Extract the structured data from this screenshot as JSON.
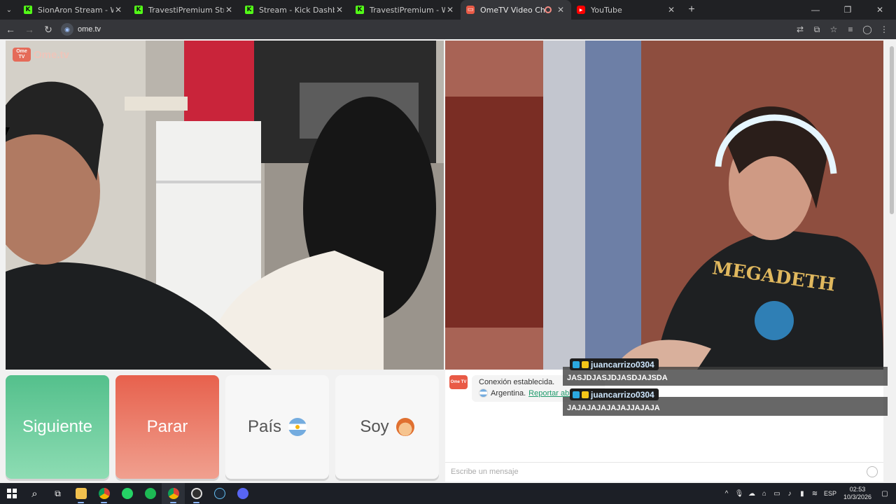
{
  "browser": {
    "tabs": [
      {
        "title": "SionAron Stream - Watch Live o",
        "favicon": "kick-icon",
        "active": false
      },
      {
        "title": "TravestiPremium Stream - Watc",
        "favicon": "kick-icon",
        "active": false
      },
      {
        "title": "Stream - Kick Dashboard",
        "favicon": "kick-icon",
        "active": false
      },
      {
        "title": "TravestiPremium - Watch clips o",
        "favicon": "kick-icon",
        "active": false
      },
      {
        "title": "OmeTV Video Chat — Ome",
        "favicon": "ometv-icon",
        "active": true
      },
      {
        "title": "YouTube",
        "favicon": "youtube-icon",
        "active": false
      }
    ],
    "url": "ome.tv"
  },
  "page": {
    "logo": {
      "wordmark": "Ome.tv",
      "badge": "Ome TV"
    },
    "buttons": {
      "next": "Siguiente",
      "stop": "Parar",
      "country": "País",
      "gender": "Soy"
    },
    "chat": {
      "system_badge": "Ome TV",
      "connected": "Conexión establecida.",
      "country": "Argentina.",
      "report": "Reportar abus",
      "placeholder": "Escribe un mensaje"
    }
  },
  "stream_overlay": {
    "messages": [
      {
        "user": "juancarrizo0304",
        "text": "JASJDJASJDJASDJAJSDA"
      },
      {
        "user": "juancarrizo0304",
        "text": "JAJAJAJAJAJAJJAJAJA"
      }
    ]
  },
  "taskbar": {
    "language": "ESP",
    "time": "02:53",
    "date": "10/3/2026"
  },
  "colors": {
    "next": "#54c08c",
    "stop": "#e7614d",
    "brand": "#e95a46",
    "link": "#1e9a6b"
  }
}
